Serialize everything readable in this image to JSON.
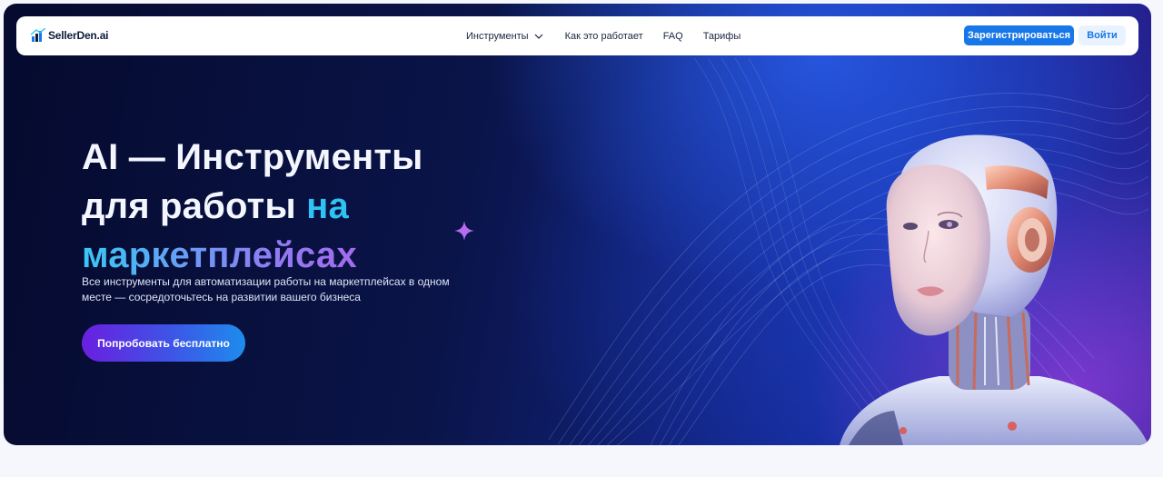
{
  "nav": {
    "logo_text": "SellerDen.ai",
    "menu": [
      {
        "label": "Инструменты"
      },
      {
        "label": "Как это работает"
      },
      {
        "label": "FAQ"
      },
      {
        "label": "Тарифы"
      }
    ],
    "register_label": "Зарегистрироваться",
    "login_label": "Войти"
  },
  "hero": {
    "headline_line1": "AI — Инструменты",
    "headline_line2_a": "для работы ",
    "headline_line2_b": "на",
    "headline_line3": "маркетплейсах",
    "subtitle": "Все инструменты для автоматизации работы на маркетплейсах в одном месте — сосредоточьтесь на развитии вашего бизнеса",
    "cta_label": "Попробовать бесплатно"
  },
  "colors": {
    "primary": "#1877e8",
    "hero_dark": "#0a1448",
    "accent_cyan": "#2fc2f5",
    "accent_purple": "#c84fe6"
  },
  "icons": {
    "logo": "ai-logo-icon",
    "chevron": "chevron-down-icon",
    "sparkle": "sparkle-icon"
  }
}
